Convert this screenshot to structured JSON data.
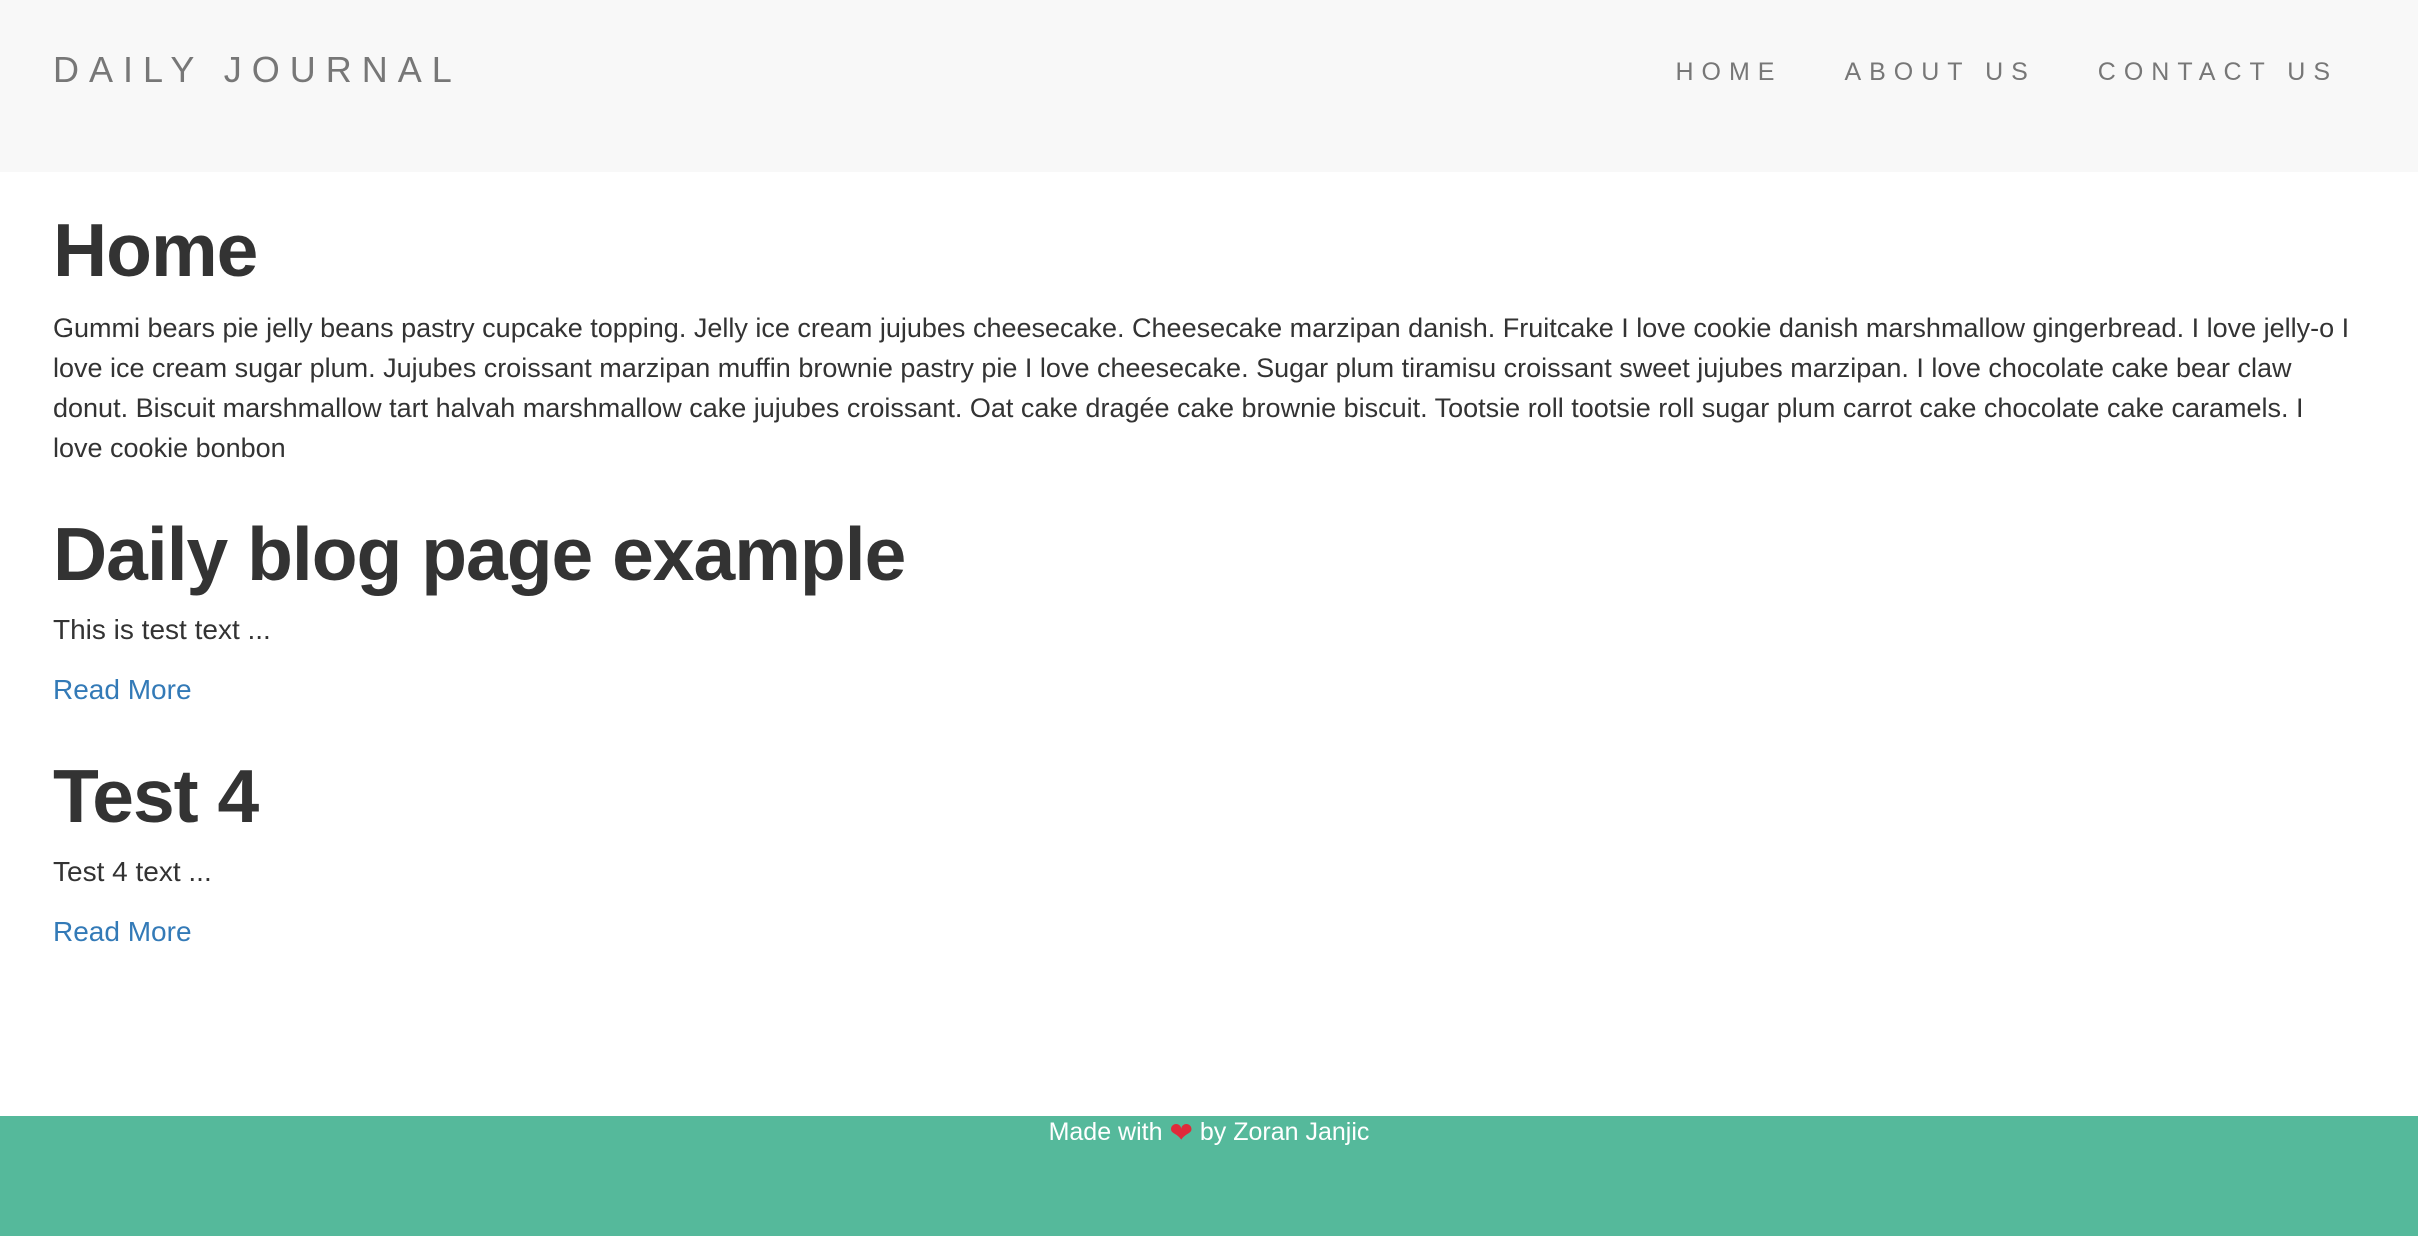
{
  "header": {
    "brand": "DAILY JOURNAL",
    "nav": [
      {
        "label": "HOME"
      },
      {
        "label": "ABOUT US"
      },
      {
        "label": "CONTACT US"
      }
    ]
  },
  "home": {
    "title": "Home",
    "intro": "Gummi bears pie jelly beans pastry cupcake topping. Jelly ice cream jujubes cheesecake. Cheesecake marzipan danish. Fruitcake I love cookie danish marshmallow gingerbread. I love jelly-o I love ice cream sugar plum. Jujubes croissant marzipan muffin brownie pastry pie I love cheesecake. Sugar plum tiramisu croissant sweet jujubes marzipan. I love chocolate cake bear claw donut. Biscuit marshmallow tart halvah marshmallow cake jujubes croissant. Oat cake dragée cake brownie biscuit. Tootsie roll tootsie roll sugar plum carrot cake chocolate cake caramels. I love cookie bonbon"
  },
  "posts": [
    {
      "title": "Daily blog page example",
      "excerpt": "This is test text ...",
      "link_label": "Read More"
    },
    {
      "title": "Test 4",
      "excerpt": "Test 4 text ...",
      "link_label": "Read More"
    }
  ],
  "footer": {
    "prefix": "Made with",
    "heart": "❤",
    "suffix": "by Zoran Janjic"
  },
  "colors": {
    "navbar_bg": "#f8f8f8",
    "link": "#337ab7",
    "footer_bg": "#55b99b",
    "heart": "#e0293a"
  }
}
